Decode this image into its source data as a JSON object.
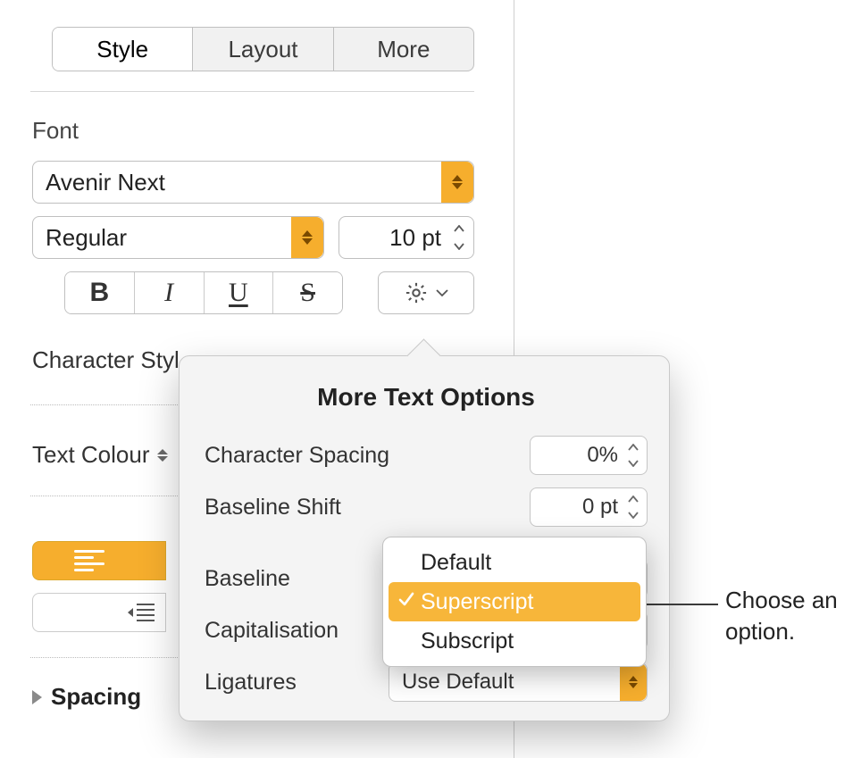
{
  "tabs": {
    "style": "Style",
    "layout": "Layout",
    "more": "More"
  },
  "font": {
    "section": "Font",
    "family": "Avenir Next",
    "weight": "Regular",
    "size": "10 pt"
  },
  "character_styles_label": "Character Styl",
  "text_colour_label": "Text Colour",
  "spacing_label": "Spacing",
  "popover": {
    "title": "More Text Options",
    "char_spacing_label": "Character Spacing",
    "char_spacing_value": "0%",
    "baseline_shift_label": "Baseline Shift",
    "baseline_shift_value": "0 pt",
    "baseline_label": "Baseline",
    "capitalisation_label": "Capitalisation",
    "ligatures_label": "Ligatures",
    "ligatures_value": "Use Default"
  },
  "baseline_menu": {
    "default": "Default",
    "superscript": "Superscript",
    "subscript": "Subscript"
  },
  "callout": "Choose an\noption."
}
